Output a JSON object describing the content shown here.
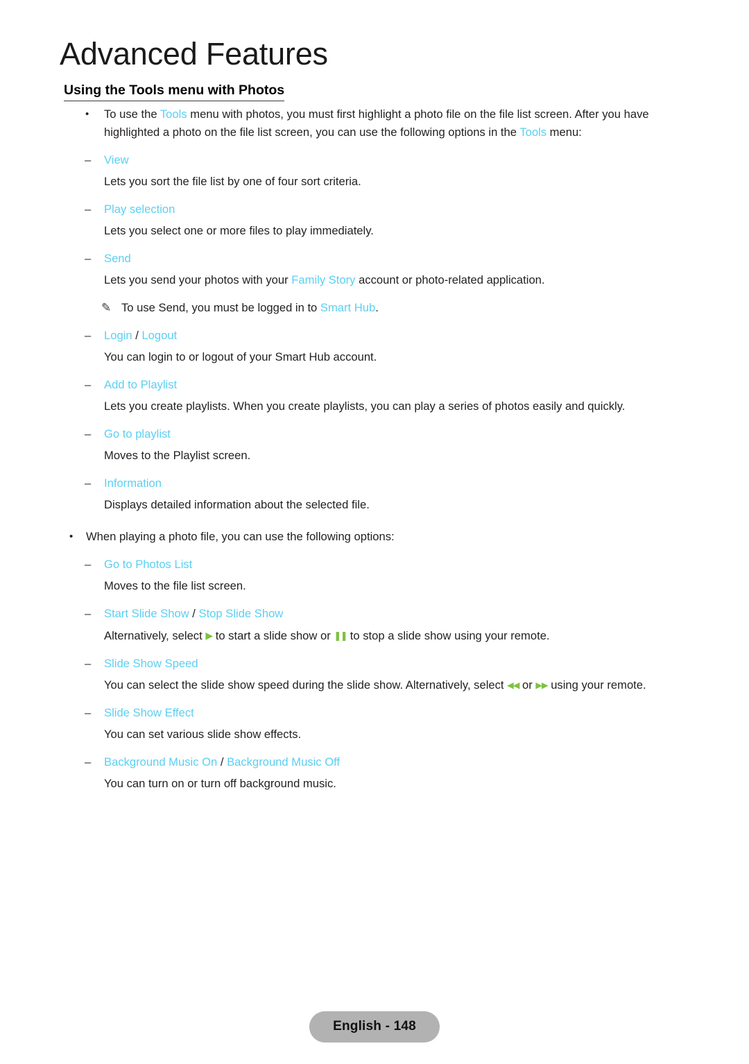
{
  "colors": {
    "accent_cyan": "#5bcff2",
    "remote_green": "#7dc242",
    "body_text": "#231f20",
    "badge_bg": "#b2b2b2"
  },
  "header": {
    "title": "Advanced Features",
    "section_heading": "Using the Tools menu with Photos"
  },
  "icons": {
    "bullet": "•",
    "dash": "–",
    "pencil": "✎",
    "play": "▶",
    "pause": "❚❚",
    "rewind": "◀◀",
    "fast_forward": "▶▶",
    "slash": "/"
  },
  "intro_bullet": {
    "part1": "To use the ",
    "link1": "Tools",
    "part2": " menu with photos, you must first highlight a photo file on the file list screen. After you have highlighted a photo on the file list screen, you can use the following options in the ",
    "link2": "Tools",
    "part3": " menu:"
  },
  "tools_options": [
    {
      "label": "View",
      "description": "Lets you sort the file list by one of four sort criteria."
    },
    {
      "label": "Play selection",
      "description": "Lets you select one or more files to play immediately."
    },
    {
      "label": "Send",
      "desc_part1": "Lets you send your photos with your ",
      "desc_link": "Family Story",
      "desc_part2": " account or photo-related application.",
      "note_part1": "To use Send, you must be logged in to ",
      "note_link": "Smart Hub",
      "note_part2": "."
    },
    {
      "label": "Login",
      "label2": "Logout",
      "description": "You can login to or logout of your Smart Hub account."
    },
    {
      "label": "Add to Playlist",
      "description": "Lets you create playlists. When you create playlists, you can play a series of photos easily and quickly."
    },
    {
      "label": "Go to playlist",
      "description": "Moves to the Playlist screen."
    },
    {
      "label": "Information",
      "description": "Displays detailed information about the selected file."
    }
  ],
  "playing_bullet": {
    "text": "When playing a photo file, you can use the following options:"
  },
  "playing_options": [
    {
      "label": "Go to Photos List",
      "description": "Moves to the file list screen."
    },
    {
      "label": "Start Slide Show",
      "label2": "Stop Slide Show",
      "desc_part1": "Alternatively, select ",
      "desc_part2": " to start a slide show or ",
      "desc_part3": " to stop a slide show using your remote."
    },
    {
      "label": "Slide Show Speed",
      "desc_part1": "You can select the slide show speed during the slide show. Alternatively, select ",
      "desc_part2": " or ",
      "desc_part3": " using your remote."
    },
    {
      "label": "Slide Show Effect",
      "description": "You can set various slide show effects."
    },
    {
      "label": "Background Music On",
      "label2": "Background Music Off",
      "description": "You can turn on or turn off background music."
    }
  ],
  "footer": {
    "page_label": "English - 148"
  }
}
